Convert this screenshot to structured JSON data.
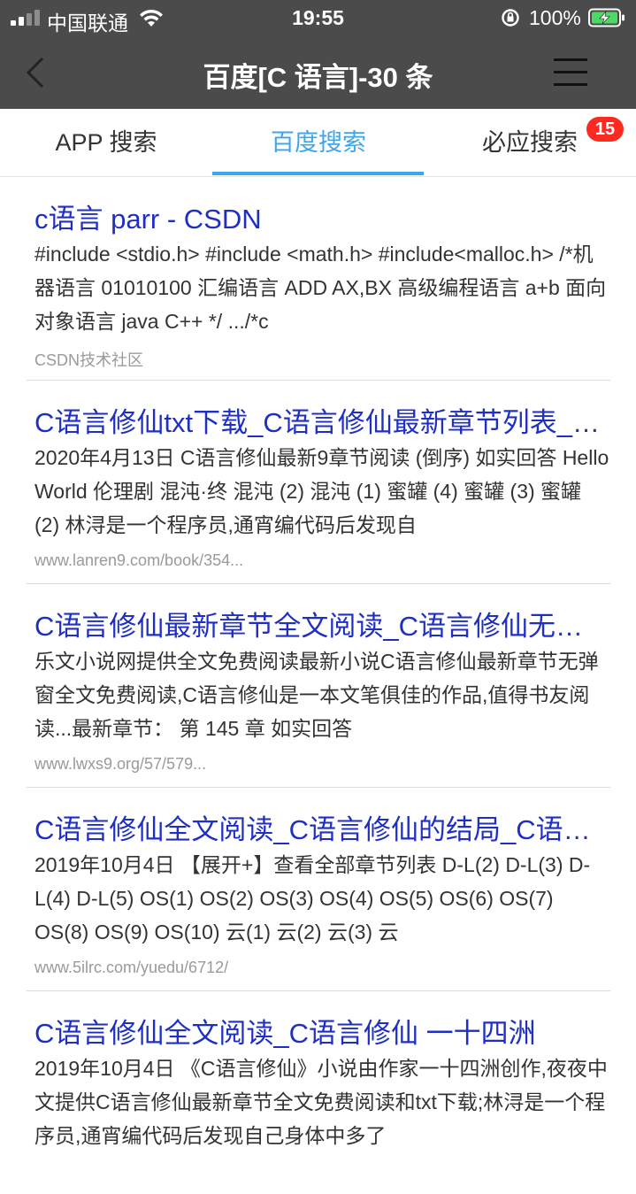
{
  "status_bar": {
    "carrier": "中国联通",
    "time": "19:55",
    "battery_percent": "100%"
  },
  "navbar": {
    "title": "百度[C 语言]-30 条"
  },
  "tabs": [
    {
      "label": "APP 搜索",
      "active": false
    },
    {
      "label": "百度搜索",
      "active": true
    },
    {
      "label": "必应搜索",
      "active": false
    }
  ],
  "badge": "15",
  "results": [
    {
      "title": "c语言 parr - CSDN",
      "snippet": "#include <stdio.h> #include <math.h> #include<malloc.h> /*机器语言 01010100 汇编语言 ADD AX,BX 高级编程语言 a+b 面向对象语言 java C++ */ .../*c",
      "source": "CSDN技术社区"
    },
    {
      "title": "C语言修仙txt下载_C语言修仙最新章节列表_C语言修仙",
      "snippet": "2020年4月13日 C语言修仙最新9章节阅读 (倒序) 如实回答 Hello World 伦理剧 混沌·终 混沌 (2) 混沌 (1) 蜜罐 (4) 蜜罐 (3) 蜜罐 (2) 林浔是一个程序员,通宵编代码后发现自",
      "source": "www.lanren9.com/book/354..."
    },
    {
      "title": "C语言修仙最新章节全文阅读_C语言修仙无弹窗",
      "snippet": "乐文小说网提供全文免费阅读最新小说C语言修仙最新章节无弹窗全文免费阅读,C语言修仙是一本文笔俱佳的作品,值得书友阅读...最新章节： 第 145 章 如实回答",
      "source": "www.lwxs9.org/57/579..."
    },
    {
      "title": "C语言修仙全文阅读_C语言修仙的结局_C语言修仙",
      "snippet": "2019年10月4日 【展开+】查看全部章节列表 D-L(2) D-L(3) D-L(4) D-L(5) OS(1) OS(2) OS(3) OS(4) OS(5) OS(6) OS(7) OS(8) OS(9) OS(10) 云(1) 云(2) 云(3) 云",
      "source": "www.5ilrc.com/yuedu/6712/"
    },
    {
      "title": "C语言修仙全文阅读_C语言修仙 一十四洲",
      "snippet": "2019年10月4日 《C语言修仙》小说由作家一十四洲创作,夜夜中文提供C语言修仙最新章节全文免费阅读和txt下载;林浔是一个程序员,通宵编代码后发现自己身体中多了",
      "source": ""
    }
  ]
}
